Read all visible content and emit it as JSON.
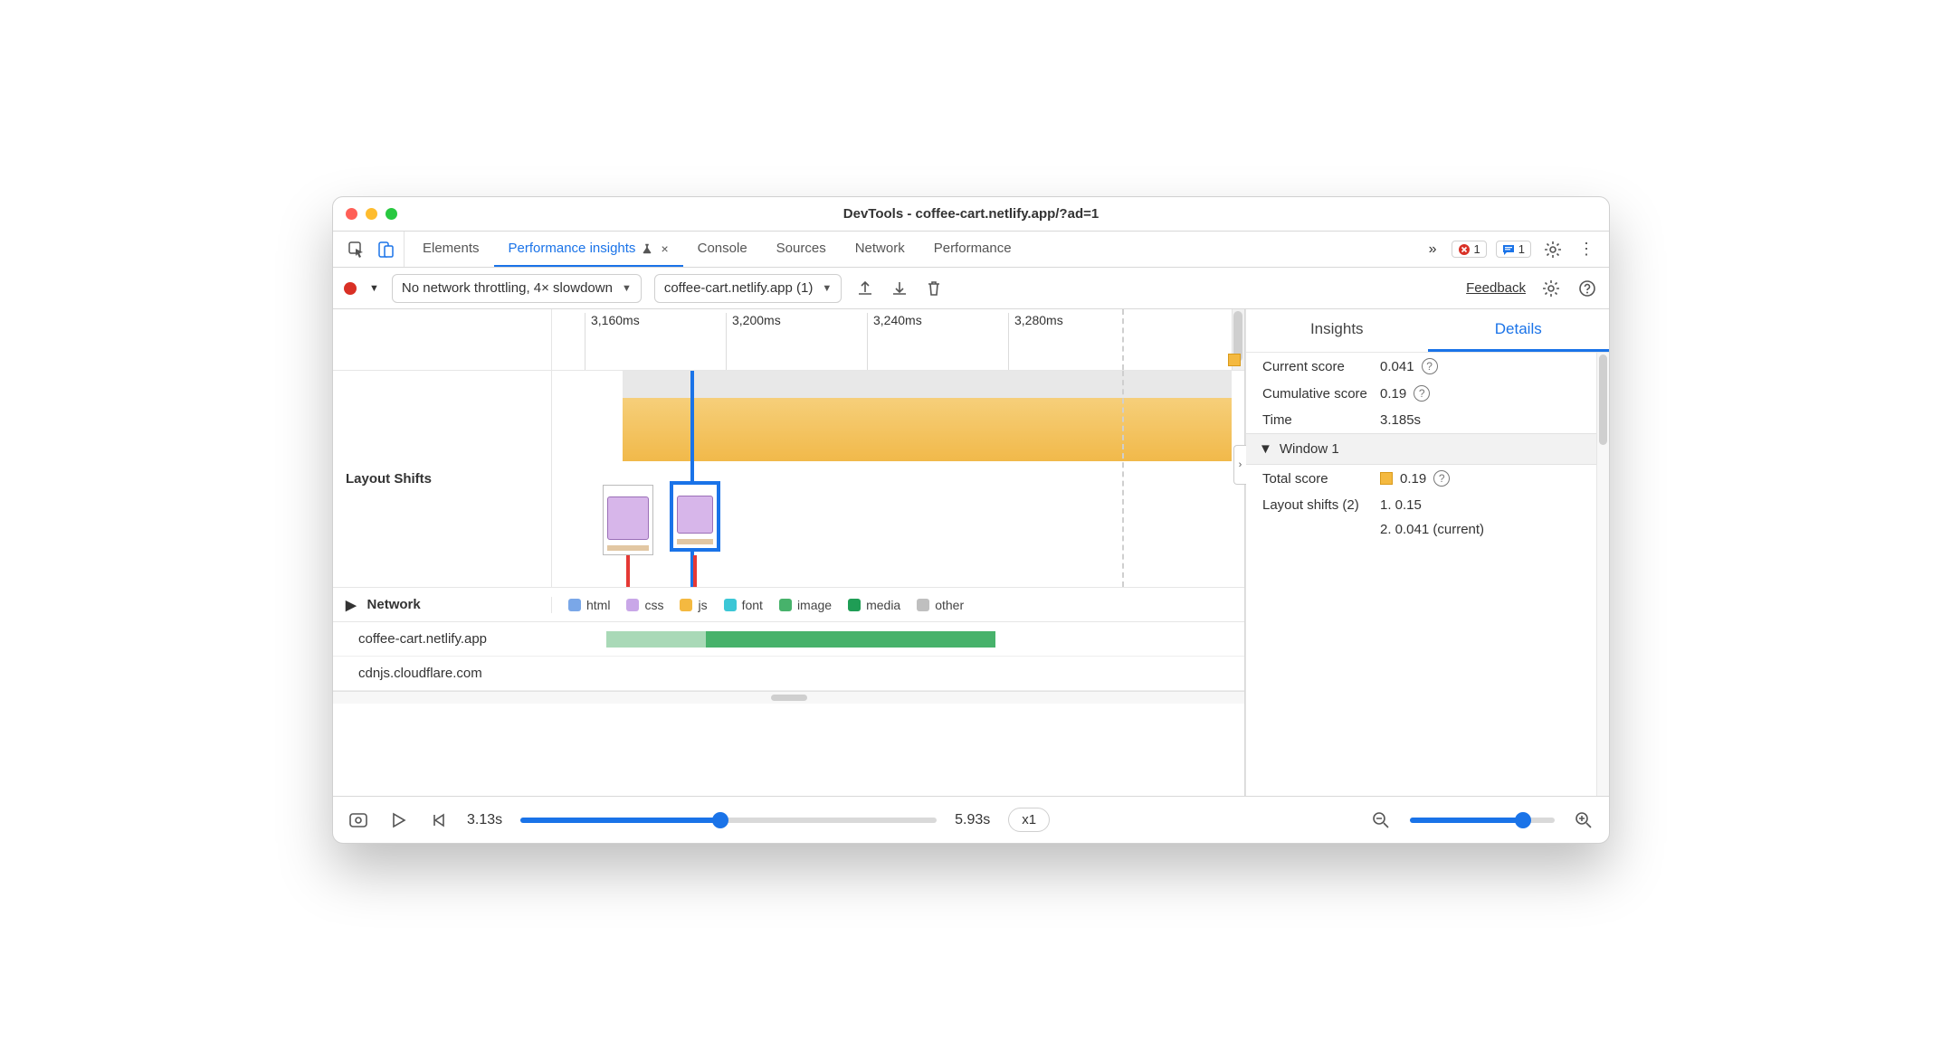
{
  "window_title": "DevTools - coffee-cart.netlify.app/?ad=1",
  "tabs": {
    "elements": "Elements",
    "perf_insights": "Performance insights",
    "console": "Console",
    "sources": "Sources",
    "network": "Network",
    "performance": "Performance"
  },
  "badges": {
    "errors": "1",
    "messages": "1"
  },
  "toolbar": {
    "throttle_label": "No network throttling, 4× slowdown",
    "page_select_label": "coffee-cart.netlify.app (1)",
    "feedback": "Feedback"
  },
  "timeline": {
    "ticks": [
      "3,160ms",
      "3,200ms",
      "3,240ms",
      "3,280ms"
    ],
    "layout_shifts_label": "Layout Shifts",
    "network_label": "Network",
    "legend": {
      "html": "html",
      "css": "css",
      "js": "js",
      "font": "font",
      "image": "image",
      "media": "media",
      "other": "other"
    },
    "legend_colors": {
      "html": "#7aa7e8",
      "css": "#c9a7e8",
      "js": "#f4b940",
      "font": "#3cc7d6",
      "image": "#47b26b",
      "media": "#1f9d55",
      "other": "#bfbfbf"
    },
    "hosts": [
      "coffee-cart.netlify.app",
      "cdnjs.cloudflare.com"
    ]
  },
  "details": {
    "tab_insights": "Insights",
    "tab_details": "Details",
    "current_score_label": "Current score",
    "current_score_value": "0.041",
    "cumulative_score_label": "Cumulative score",
    "cumulative_score_value": "0.19",
    "time_label": "Time",
    "time_value": "3.185s",
    "window_header": "Window 1",
    "total_score_label": "Total score",
    "total_score_value": "0.19",
    "layout_shifts_label": "Layout shifts (2)",
    "shift_1": "1. 0.15",
    "shift_2": "2. 0.041 (current)"
  },
  "footer": {
    "time_start": "3.13s",
    "time_end": "5.93s",
    "speed": "x1"
  }
}
